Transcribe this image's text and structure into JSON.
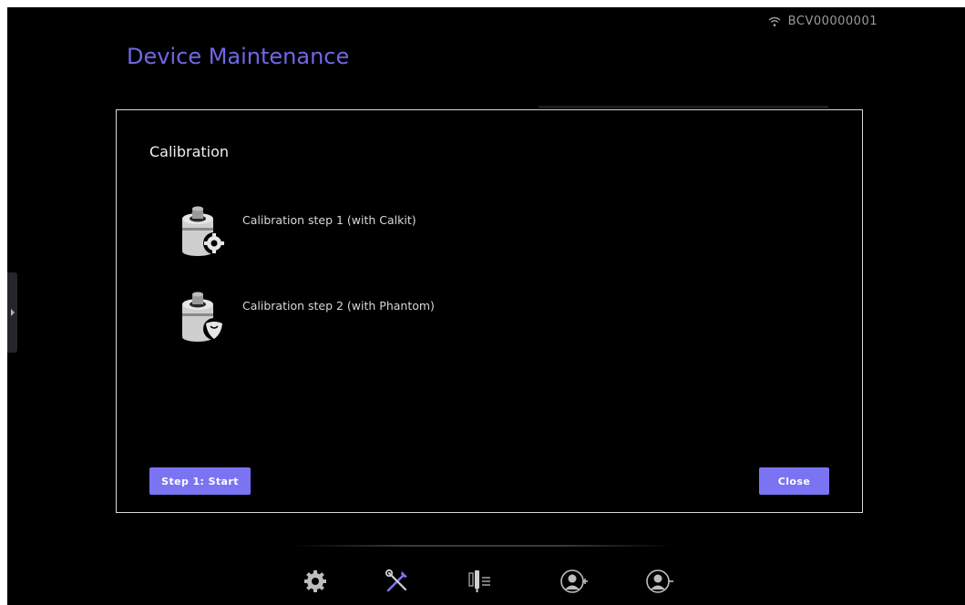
{
  "status_bar": {
    "device_id": "BCV00000001",
    "wifi_icon": "wifi-icon"
  },
  "page": {
    "title": "Device Maintenance"
  },
  "dialog": {
    "title": "Calibration",
    "steps": [
      {
        "label": "Calibration step 1 (with Calkit)",
        "icon": "calkit-gear-icon"
      },
      {
        "label": "Calibration step 2 (with Phantom)",
        "icon": "phantom-icon"
      }
    ],
    "start_button": "Step 1: Start",
    "close_button": "Close"
  },
  "nav": {
    "items": [
      {
        "icon": "settings-gear-icon"
      },
      {
        "icon": "maintenance-tools-icon"
      },
      {
        "icon": "probe-list-icon"
      },
      {
        "icon": "add-user-icon"
      },
      {
        "icon": "remove-user-icon"
      }
    ]
  },
  "colors": {
    "accent": "#6f67e6",
    "button": "#7b74f2",
    "background": "#000000"
  }
}
